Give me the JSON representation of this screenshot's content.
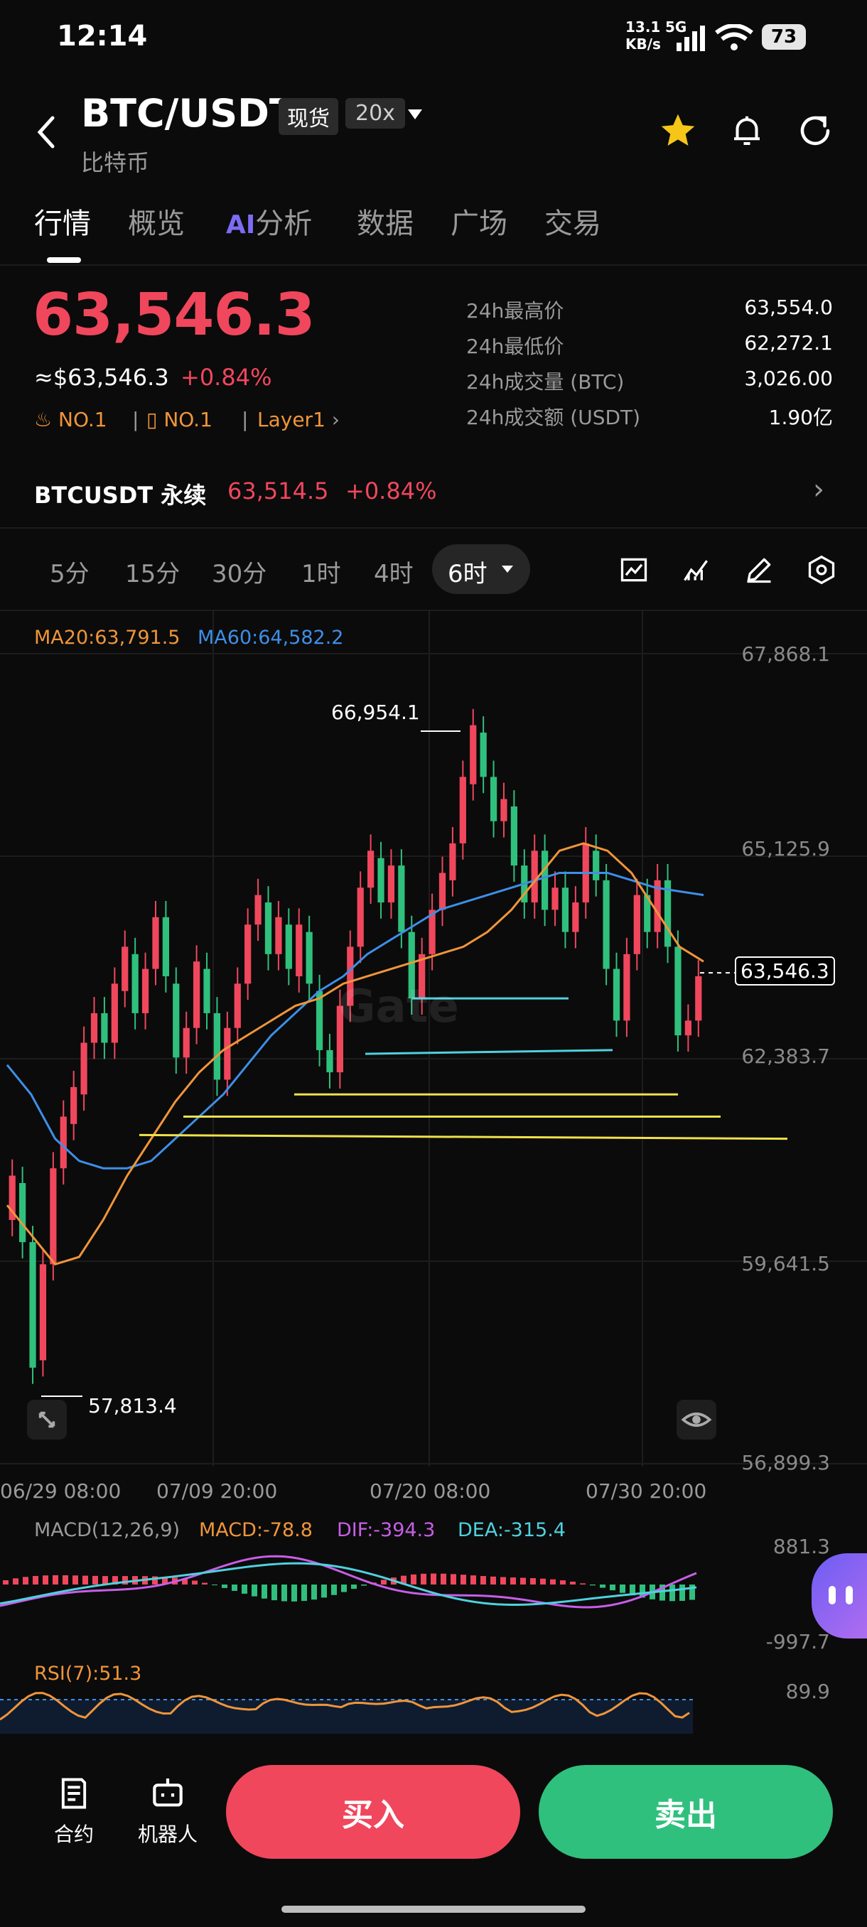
{
  "status_bar": {
    "time": "12:14",
    "net_speed": "13.1 KB/s",
    "network": "5G",
    "battery": "73"
  },
  "header": {
    "pair": "BTC/USDT",
    "badge_spot": "现货",
    "badge_leverage": "20x",
    "subtitle": "比特币"
  },
  "tabs": [
    {
      "label": "行情",
      "active": true
    },
    {
      "label": "概览"
    },
    {
      "ai_prefix": "AI",
      "label": "分析"
    },
    {
      "label": "数据"
    },
    {
      "label": "广场"
    },
    {
      "label": "交易"
    }
  ],
  "price": {
    "last": "63,546.3",
    "usd_equiv": "≈$63,546.3",
    "change": "+0.84%"
  },
  "tags": {
    "rank1": "NO.1",
    "rank2": "NO.1",
    "category": "Layer1"
  },
  "stats": [
    {
      "label": "24h最高价",
      "value": "63,554.0"
    },
    {
      "label": "24h最低价",
      "value": "62,272.1"
    },
    {
      "label": "24h成交量 (BTC)",
      "value": "3,026.00"
    },
    {
      "label": "24h成交额 (USDT)",
      "value": "1.90亿"
    }
  ],
  "perp": {
    "name": "BTCUSDT 永续",
    "price": "63,514.5",
    "change": "+0.84%"
  },
  "timeframes": [
    "5分",
    "15分",
    "30分",
    "1时",
    "4时",
    "6时"
  ],
  "selected_timeframe": "6时",
  "chart": {
    "ma20": "MA20:63,791.5",
    "ma60": "MA60:64,582.2",
    "y_ticks": [
      "67,868.1",
      "65,125.9",
      "62,383.7",
      "59,641.5",
      "56,899.3"
    ],
    "high_label": "66,954.1",
    "low_label": "57,813.4",
    "current_tag": "63,546.3",
    "watermark": "Gate",
    "dates": [
      "06/29 08:00",
      "07/09 20:00",
      "07/20 08:00",
      "07/30 20:00"
    ]
  },
  "chart_data": {
    "type": "candlestick",
    "ylim": [
      56899.3,
      67868.1
    ],
    "y_ticks": [
      67868.1,
      65125.9,
      62383.7,
      59641.5,
      56899.3
    ],
    "x_labels": [
      "06/29 08:00",
      "07/09 20:00",
      "07/20 08:00",
      "07/30 20:00"
    ],
    "high": 66954.1,
    "low": 57813.4,
    "last": 63546.3,
    "ma20_last": 63791.5,
    "ma60_last": 64582.2,
    "candles": [
      [
        60200,
        60800
      ],
      [
        60700,
        59900
      ],
      [
        59900,
        58200
      ],
      [
        58300,
        59600
      ],
      [
        59600,
        60900
      ],
      [
        60900,
        61600
      ],
      [
        61500,
        62000
      ],
      [
        61900,
        62600
      ],
      [
        62600,
        63000
      ],
      [
        63000,
        62600
      ],
      [
        62600,
        63400
      ],
      [
        63300,
        63900
      ],
      [
        63800,
        63000
      ],
      [
        63000,
        63600
      ],
      [
        63600,
        64300
      ],
      [
        64300,
        63500
      ],
      [
        63400,
        62400
      ],
      [
        62400,
        62800
      ],
      [
        62800,
        63700
      ],
      [
        63600,
        63000
      ],
      [
        63000,
        62100
      ],
      [
        62100,
        62800
      ],
      [
        62800,
        63400
      ],
      [
        63400,
        64200
      ],
      [
        64200,
        64600
      ],
      [
        64500,
        63800
      ],
      [
        63800,
        64300
      ],
      [
        64200,
        63600
      ],
      [
        63500,
        64200
      ],
      [
        64100,
        63400
      ],
      [
        63300,
        62500
      ],
      [
        62500,
        62200
      ],
      [
        62200,
        63100
      ],
      [
        63100,
        63900
      ],
      [
        63900,
        64700
      ],
      [
        64700,
        65200
      ],
      [
        65100,
        64500
      ],
      [
        64500,
        65000
      ],
      [
        65000,
        64100
      ],
      [
        64100,
        63200
      ],
      [
        63200,
        63800
      ],
      [
        63800,
        64400
      ],
      [
        64400,
        64900
      ],
      [
        64800,
        65300
      ],
      [
        65300,
        66200
      ],
      [
        66100,
        66900
      ],
      [
        66800,
        66200
      ],
      [
        66200,
        65600
      ],
      [
        65600,
        65900
      ],
      [
        65800,
        65000
      ],
      [
        65000,
        64500
      ],
      [
        64500,
        65200
      ],
      [
        65200,
        64400
      ],
      [
        64400,
        64700
      ],
      [
        64700,
        64100
      ],
      [
        64100,
        64500
      ],
      [
        64500,
        65300
      ],
      [
        65200,
        64800
      ],
      [
        64800,
        63600
      ],
      [
        63600,
        62900
      ],
      [
        62900,
        63800
      ],
      [
        63800,
        64600
      ],
      [
        64600,
        64100
      ],
      [
        64100,
        64800
      ],
      [
        64800,
        63900
      ],
      [
        63900,
        62700
      ],
      [
        62700,
        62900
      ],
      [
        62900,
        63500
      ]
    ],
    "ma20": [
      60400,
      60000,
      59600,
      59700,
      60200,
      60800,
      61300,
      61800,
      62200,
      62500,
      62700,
      62900,
      63100,
      63200,
      63400,
      63500,
      63600,
      63700,
      63800,
      63900,
      64100,
      64400,
      64800,
      65200,
      65300,
      65200,
      64900,
      64400,
      63900,
      63700
    ],
    "ma60": [
      62300,
      61900,
      61300,
      61000,
      60900,
      60900,
      61000,
      61300,
      61600,
      61900,
      62300,
      62700,
      63000,
      63300,
      63500,
      63800,
      64000,
      64200,
      64400,
      64500,
      64600,
      64700,
      64800,
      64900,
      64900,
      64900,
      64800,
      64700,
      64650,
      64600
    ],
    "support_lines": [
      {
        "from": 63200,
        "to": 63200,
        "color": "#4fd1e0"
      },
      {
        "from": 62450,
        "to": 62500,
        "color": "#4fd1e0"
      },
      {
        "from": 61900,
        "to": 61900,
        "color": "#f0e14a"
      },
      {
        "from": 61600,
        "to": 61600,
        "color": "#f0e14a"
      },
      {
        "from": 61350,
        "to": 61300,
        "color": "#f0e14a"
      }
    ]
  },
  "macd": {
    "label": "MACD(12,26,9)",
    "macd": "MACD:-78.8",
    "dif": "DIF:-394.3",
    "dea": "DEA:-315.4",
    "top": "881.3",
    "bottom": "-997.7"
  },
  "rsi": {
    "label": "RSI(7):51.3",
    "top": "89.9"
  },
  "bottom_bar": {
    "contract": "合约",
    "robot": "机器人",
    "buy": "买入",
    "sell": "卖出"
  },
  "colors": {
    "up": "#f0475d",
    "down": "#2fc07d",
    "ma20": "#f0953a",
    "ma60": "#3e8fe8",
    "accent_star": "#f5c518"
  }
}
